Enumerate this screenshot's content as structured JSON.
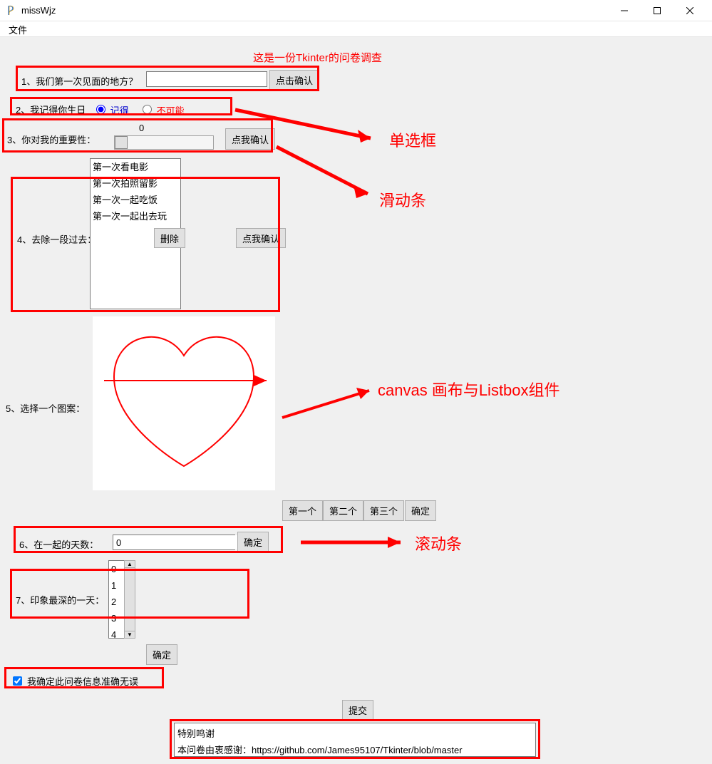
{
  "window": {
    "title": "missWjz",
    "menu_file": "文件"
  },
  "header": "这是一份Tkinter的问卷调查",
  "q1": {
    "label": "1、我们第一次见面的地方？",
    "button": "点击确认",
    "value": ""
  },
  "q2": {
    "label": "2、我记得你生日",
    "opt1": "记得",
    "opt2": "不可能"
  },
  "q3": {
    "label": "3、你对我的重要性：",
    "value": "0",
    "button": "点我确认"
  },
  "q4": {
    "label": "4、去除一段过去：",
    "items": [
      "第一次看电影",
      "第一次拍照留影",
      "第一次一起吃饭",
      "第一次一起出去玩"
    ],
    "delete_btn": "删除",
    "confirm_btn": "点我确认"
  },
  "q5": {
    "label": "5、选择一个图案："
  },
  "q5b": {
    "btn1": "第一个",
    "btn2": "第二个",
    "btn3": "第三个",
    "ok": "确定"
  },
  "q6": {
    "label": "6、在一起的天数：",
    "value": "0",
    "ok": "确定"
  },
  "q7": {
    "label": "7、印象最深的一天：",
    "items": [
      "0",
      "1",
      "2",
      "3",
      "4"
    ],
    "ok": "确定"
  },
  "confirm_check": "我确定此问卷信息准确无误",
  "submit": "提交",
  "credits": {
    "title": "特别鸣谢",
    "body": "本问卷由衷感谢：https://github.com/James95107/Tkinter/blob/master"
  },
  "annotations": {
    "radio": "单选框",
    "slider": "滑动条",
    "canvas": "canvas 画布与Listbox组件",
    "scrollbar": "滚动条"
  }
}
